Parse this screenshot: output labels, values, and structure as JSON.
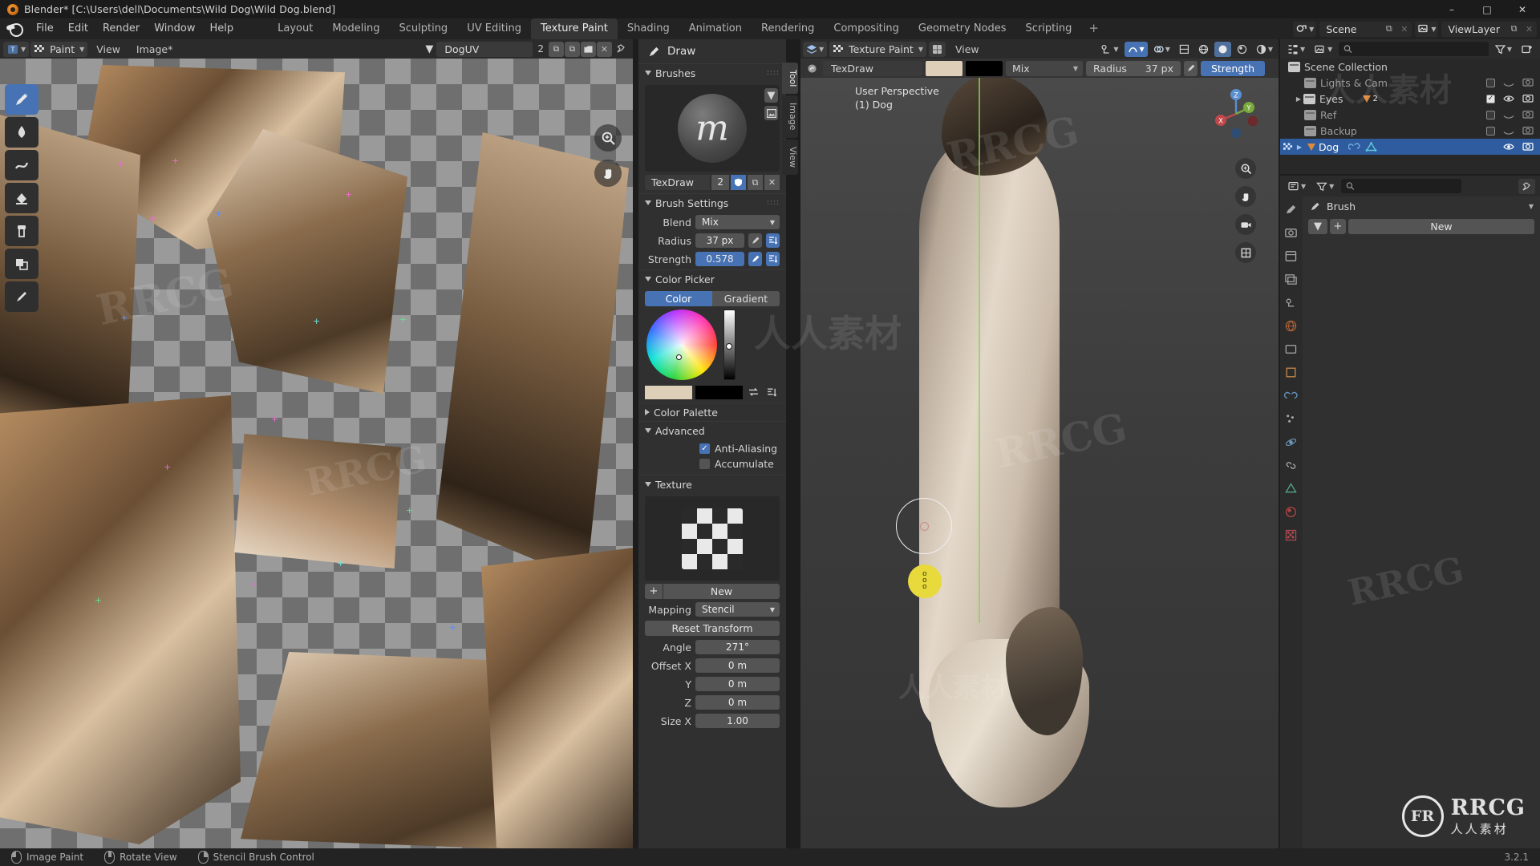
{
  "window": {
    "title": "Blender* [C:\\Users\\dell\\Documents\\Wild Dog\\Wild Dog.blend]",
    "minimize": "–",
    "maximize": "□",
    "close": "✕"
  },
  "topbar": {
    "menus": [
      "File",
      "Edit",
      "Render",
      "Window",
      "Help"
    ],
    "workspaces": [
      {
        "label": "Layout",
        "active": false
      },
      {
        "label": "Modeling",
        "active": false
      },
      {
        "label": "Sculpting",
        "active": false
      },
      {
        "label": "UV Editing",
        "active": false
      },
      {
        "label": "Texture Paint",
        "active": true
      },
      {
        "label": "Shading",
        "active": false
      },
      {
        "label": "Animation",
        "active": false
      },
      {
        "label": "Rendering",
        "active": false
      },
      {
        "label": "Compositing",
        "active": false
      },
      {
        "label": "Geometry Nodes",
        "active": false
      },
      {
        "label": "Scripting",
        "active": false
      }
    ],
    "add_workspace": "+",
    "scene_name": "Scene",
    "viewlayer_name": "ViewLayer",
    "new_icon": "⧉",
    "unlink_icon": "✕"
  },
  "image_editor": {
    "editor_type_icon": "image-editor-icon",
    "mode": "Paint",
    "menus": [
      "View",
      "Image*"
    ],
    "image_name": "DogUV",
    "image_users": "2",
    "pin_icon": "⧉",
    "copy_icon": "⧉",
    "unlink_icon": "✕",
    "tools": [
      {
        "name": "tool-draw",
        "active": true
      },
      {
        "name": "tool-soften",
        "active": false
      },
      {
        "name": "tool-smear",
        "active": false
      },
      {
        "name": "tool-fill",
        "active": false
      },
      {
        "name": "tool-clone",
        "active": false
      },
      {
        "name": "tool-mask",
        "active": false
      },
      {
        "name": "tool-annotate",
        "active": false
      }
    ],
    "nav": [
      "zoom-icon",
      "pan-icon"
    ]
  },
  "sidebar": {
    "tool_header": "Draw",
    "vertical_tabs": [
      "Tool",
      "Image",
      "View"
    ],
    "brushes": {
      "title": "Brushes",
      "brush_name": "TexDraw",
      "users": "2",
      "fake_user_icon": "shield-icon",
      "copy_icon": "⧉",
      "unlink_icon": "✕"
    },
    "brush_settings": {
      "title": "Brush Settings",
      "blend_label": "Blend",
      "blend_value": "Mix",
      "radius_label": "Radius",
      "radius_value": "37 px",
      "strength_label": "Strength",
      "strength_value": "0.578"
    },
    "color_picker": {
      "title": "Color Picker",
      "tab_color": "Color",
      "tab_gradient": "Gradient",
      "primary_color": "#ded0b8",
      "secondary_color": "#000000",
      "swap_icon": "⇄"
    },
    "color_palette": {
      "title": "Color Palette"
    },
    "advanced": {
      "title": "Advanced",
      "anti_aliasing_label": "Anti-Aliasing",
      "anti_aliasing_checked": true,
      "accumulate_label": "Accumulate",
      "accumulate_checked": false
    },
    "texture": {
      "title": "Texture",
      "new_label": "New",
      "plus_icon": "+",
      "mapping_label": "Mapping",
      "mapping_value": "Stencil",
      "reset_transform": "Reset Transform",
      "angle_label": "Angle",
      "angle_value": "271°",
      "offset_x_label": "Offset X",
      "offset_x_value": "0 m",
      "offset_y_label": "Y",
      "offset_y_value": "0 m",
      "offset_z_label": "Z",
      "offset_z_value": "0 m",
      "size_x_label": "Size X",
      "size_x_value": "1.00"
    }
  },
  "viewport": {
    "mode": "Texture Paint",
    "view_menu": "View",
    "perspective_line1": "User Perspective",
    "perspective_line2": "(1) Dog",
    "brush_name": "TexDraw",
    "primary_color": "#ded0b8",
    "secondary_color": "#000000",
    "blend_value": "Mix",
    "radius_label": "Radius",
    "radius_value": "37 px",
    "strength_label": "Strength",
    "gizmo_axes": [
      "X",
      "Y",
      "Z"
    ]
  },
  "outliner": {
    "search_placeholder": "",
    "display_mode_icon": "outliner-icon",
    "filter_icon": "funnel-icon",
    "new_collection_icon": "new-collection-icon",
    "rows": [
      {
        "label": "Scene Collection",
        "indent": 0,
        "kind": "collection",
        "selected": false,
        "checkbox": null,
        "eye": false,
        "camera": false,
        "expand": false
      },
      {
        "label": "Lights & Cam",
        "indent": 1,
        "kind": "collection",
        "selected": false,
        "checkbox": false,
        "eye": false,
        "camera": true,
        "expand": false
      },
      {
        "label": "Eyes",
        "indent": 1,
        "kind": "collection",
        "selected": false,
        "checkbox": true,
        "eye": true,
        "camera": true,
        "expand": true,
        "badge": "2"
      },
      {
        "label": "Ref",
        "indent": 1,
        "kind": "collection",
        "selected": false,
        "checkbox": false,
        "eye": false,
        "camera": true,
        "expand": false
      },
      {
        "label": "Backup",
        "indent": 1,
        "kind": "collection",
        "selected": false,
        "checkbox": false,
        "eye": false,
        "camera": true,
        "expand": false
      },
      {
        "label": "Dog",
        "indent": 1,
        "kind": "object",
        "selected": true,
        "checkbox": null,
        "eye": true,
        "camera": true,
        "expand": true
      }
    ]
  },
  "properties": {
    "search_placeholder": "",
    "breadcrumb": "Brush",
    "new_label": "New",
    "plus_icon": "+",
    "tabs": [
      "tool-tab",
      "render-tab",
      "output-tab",
      "viewlayer-tab",
      "scene-tab",
      "world-tab",
      "collection-tab",
      "object-tab",
      "modifier-tab",
      "particles-tab",
      "physics-tab",
      "constraints-tab",
      "data-tab",
      "material-tab",
      "texture-tab"
    ]
  },
  "status_bar": {
    "items": [
      {
        "icon": "mouse-left-icon",
        "label": "Image Paint"
      },
      {
        "icon": "mouse-middle-icon",
        "label": "Rotate View"
      },
      {
        "icon": "mouse-right-icon",
        "label": "Stencil Brush Control"
      }
    ],
    "version": "3.2.1"
  },
  "watermarks": {
    "brand": "RRCG",
    "chinese": "人人素材",
    "logo_text": "FR"
  }
}
